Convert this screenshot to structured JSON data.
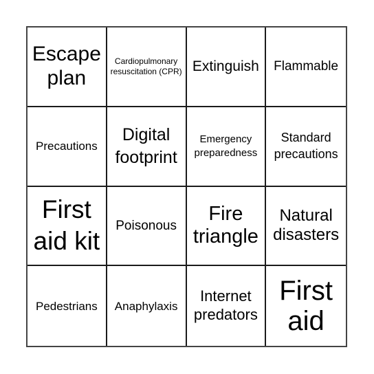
{
  "card": {
    "cells": [
      [
        "Escape plan",
        "Cardiopulmonary resuscitation (CPR)",
        "Extinguish",
        "Flammable"
      ],
      [
        "Precautions",
        "Digital footprint",
        "Emergency preparedness",
        "Standard precautions"
      ],
      [
        "First aid kit",
        "Poisonous",
        "Fire triangle",
        "Natural disasters"
      ],
      [
        "Pedestrians",
        "Anaphylaxis",
        "Internet predators",
        "First aid"
      ]
    ]
  }
}
